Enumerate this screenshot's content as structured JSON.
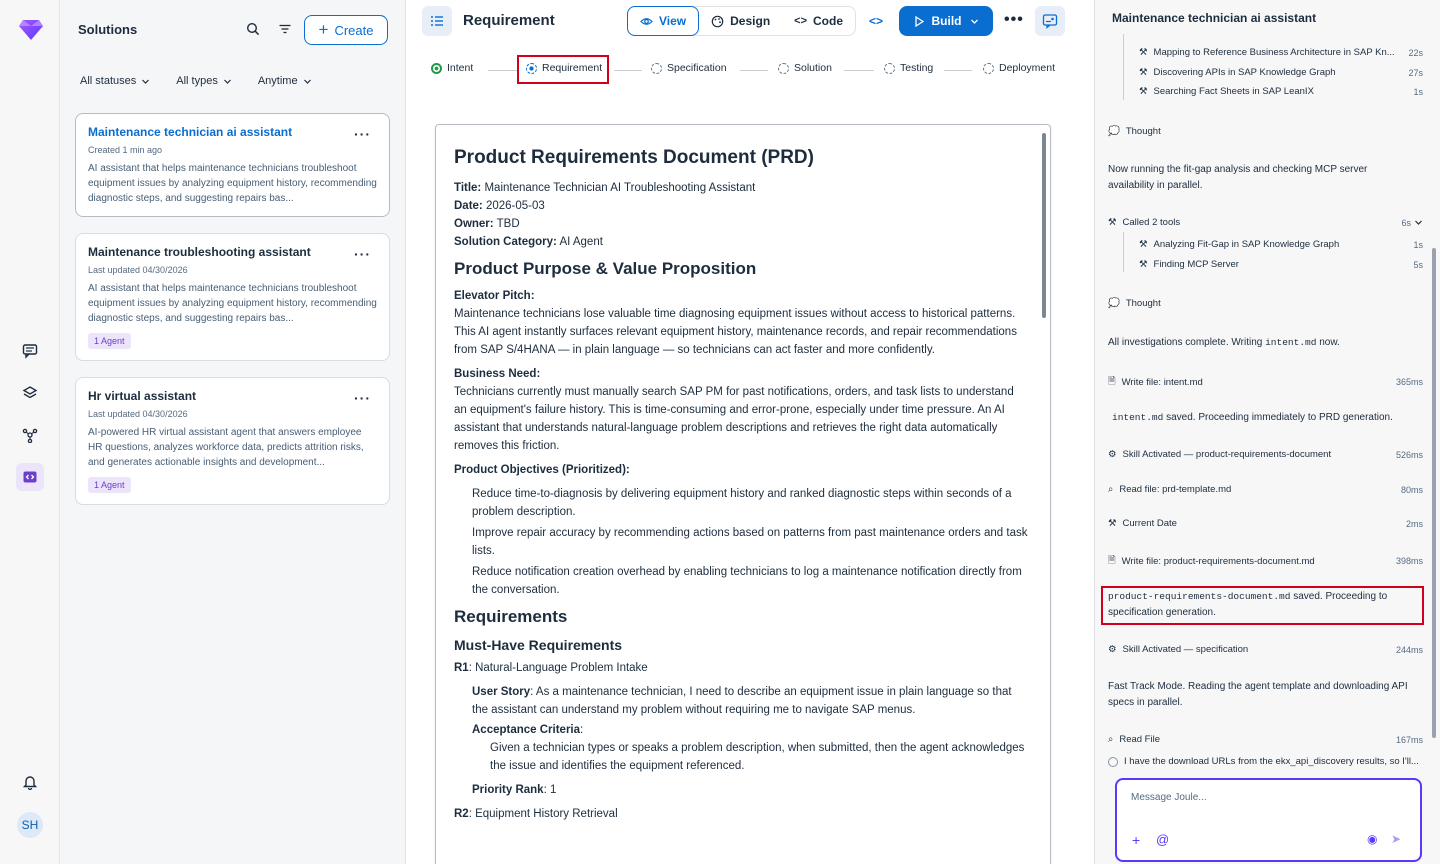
{
  "rail": {
    "avatar": "SH",
    "accent": "#6b3fc9"
  },
  "solutions": {
    "title": "Solutions",
    "create_label": "Create",
    "filters": [
      "All statuses",
      "All types",
      "Anytime"
    ],
    "cards": [
      {
        "title": "Maintenance technician ai assistant",
        "meta": "Created  1 min ago",
        "desc": "AI assistant that helps maintenance technicians troubleshoot equipment issues by analyzing equipment history, recommending diagnostic steps, and suggesting repairs bas...",
        "badge": ""
      },
      {
        "title": "Maintenance troubleshooting assistant",
        "meta": "Last updated  04/30/2026",
        "desc": "AI assistant that helps maintenance technicians troubleshoot equipment issues by analyzing equipment history, recommending diagnostic steps, and suggesting repairs bas...",
        "badge": "1 Agent"
      },
      {
        "title": "Hr virtual assistant",
        "meta": "Last updated  04/30/2026",
        "desc": "AI-powered HR virtual assistant agent that answers employee HR questions, analyzes workforce data, predicts attrition risks, and generates actionable insights and development...",
        "badge": "1 Agent"
      }
    ]
  },
  "header": {
    "title": "Requirement",
    "view_label": "View",
    "design_label": "Design",
    "code_label": "Code",
    "build_label": "Build"
  },
  "steps": [
    "Intent",
    "Requirement",
    "Specification",
    "Solution",
    "Testing",
    "Deployment"
  ],
  "doc": {
    "h1": "Product Requirements Document (PRD)",
    "title_k": "Title:",
    "title_v": "Maintenance Technician AI Troubleshooting Assistant",
    "date_k": "Date:",
    "date_v": "2026-05-03",
    "owner_k": "Owner:",
    "owner_v": "TBD",
    "cat_k": "Solution Category:",
    "cat_v": "AI Agent",
    "h2_purpose": "Product Purpose & Value Proposition",
    "pitch_label": "Elevator Pitch:",
    "pitch": "Maintenance technicians lose valuable time diagnosing equipment issues without access to historical patterns. This AI agent instantly surfaces relevant equipment history, maintenance records, and repair recommendations from SAP S/4HANA — in plain language — so technicians can act faster and more confidently.",
    "need_label": "Business Need:",
    "need": "Technicians currently must manually search SAP PM for past notifications, orders, and task lists to understand an equipment's failure history. This is time-consuming and error-prone, especially under time pressure. An AI assistant that understands natural-language problem descriptions and retrieves the right data automatically removes this friction.",
    "obj_label": "Product Objectives (Prioritized):",
    "objectives": [
      "Reduce time-to-diagnosis by delivering equipment history and ranked diagnostic steps within seconds of a problem description.",
      "Improve repair accuracy by recommending actions based on patterns from past maintenance orders and task lists.",
      "Reduce notification creation overhead by enabling technicians to log a maintenance notification directly from the conversation."
    ],
    "h2_req": "Requirements",
    "h3_must": "Must-Have Requirements",
    "r1_k": "R1",
    "r1_v": ": Natural-Language Problem Intake",
    "story_k": "User Story",
    "story_v": ": As a maintenance technician, I need to describe an equipment issue in plain language so that the assistant can understand my problem without requiring me to navigate SAP menus.",
    "ac_k": "Acceptance Criteria",
    "ac_v": ":",
    "ac_text": "Given a technician types or speaks a problem description, when submitted, then the agent acknowledges the issue and identifies the equipment referenced.",
    "prio_k": "Priority Rank",
    "prio_v": ": 1",
    "r2_k": "R2",
    "r2_v": ": Equipment History Retrieval"
  },
  "chat": {
    "title": "Maintenance technician ai assistant",
    "tools1": [
      {
        "label": "Mapping to Reference Business Architecture in SAP Kn...",
        "ms": "22s"
      },
      {
        "label": "Discovering APIs in SAP Knowledge Graph",
        "ms": "27s"
      },
      {
        "label": "Searching Fact Sheets in SAP LeanIX",
        "ms": "1s"
      }
    ],
    "thought1": "Thought",
    "text1": "Now running the fit-gap analysis and checking MCP server availability in parallel.",
    "called_label": "Called 2 tools",
    "called_ms": "6s",
    "tools2": [
      {
        "label": "Analyzing Fit-Gap in SAP Knowledge Graph",
        "ms": "1s"
      },
      {
        "label": "Finding MCP Server",
        "ms": "5s"
      }
    ],
    "thought2": "Thought",
    "text2a": "All investigations complete. Writing ",
    "text2code": "intent.md",
    "text2b": " now.",
    "write1": {
      "label": "Write file: intent.md",
      "ms": "365ms"
    },
    "saved1code": "intent.md",
    "saved1": " saved. Proceeding immediately to PRD generation.",
    "skill1": {
      "label": "Skill Activated — product-requirements-document",
      "ms": "526ms"
    },
    "read1": {
      "label": "Read file: prd-template.md",
      "ms": "80ms"
    },
    "date": {
      "label": "Current Date",
      "ms": "2ms"
    },
    "write2": {
      "label": "Write file: product-requirements-document.md",
      "ms": "398ms"
    },
    "saved2code": "product-requirements-document.md",
    "saved2": " saved. Proceeding to specification generation.",
    "skill2": {
      "label": "Skill Activated — specification",
      "ms": "244ms"
    },
    "text3": "Fast Track Mode. Reading the agent template and downloading API specs in parallel.",
    "read2": {
      "label": "Read File",
      "ms": "167ms"
    },
    "pending": "I have the download URLs from the ekx_api_discovery results, so I'll...",
    "placeholder": "Message Joule..."
  }
}
